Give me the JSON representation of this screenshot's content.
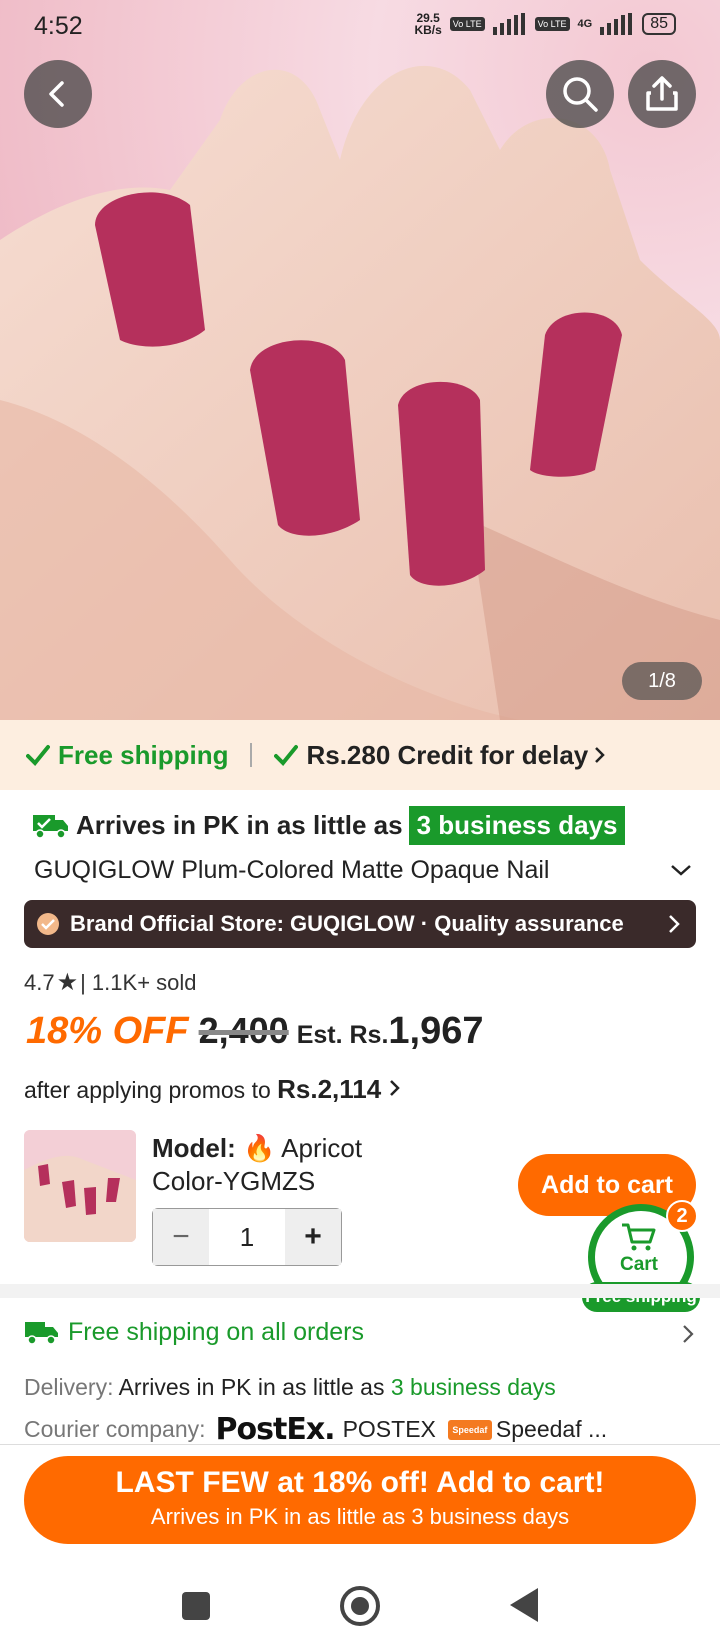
{
  "status_bar": {
    "time": "4:52",
    "net_speed_value": "29.5",
    "net_speed_unit": "KB/s",
    "lte1": "Vo LTE",
    "lte2": "Vo LTE",
    "network": "4G",
    "battery": "85"
  },
  "hero": {
    "image_counter": "1/8",
    "nail_color": "#b5305c"
  },
  "shipping_strip": {
    "free_shipping": "Free shipping",
    "credit": "Rs.280 Credit for delay"
  },
  "arrival": {
    "text": "Arrives in PK in as little as",
    "badge": "3 business days"
  },
  "product": {
    "title": "GUQIGLOW Plum-Colored Matte Opaque Nail",
    "store": "Brand Official Store: GUQIGLOW · Quality assurance",
    "rating": "4.7",
    "sold": "| 1.1K+ sold",
    "discount": "18% OFF",
    "original_price": "2,400",
    "est_label": "Est. Rs.",
    "final_price": "1,967",
    "promo_text": "after applying promos to",
    "promo_price": "Rs.2,114"
  },
  "model": {
    "label": "Model:",
    "value_line1": "Apricot",
    "value_line2": "Color-YGMZS",
    "quantity": "1",
    "minus": "−",
    "plus": "+"
  },
  "buttons": {
    "add_to_cart": "Add to cart",
    "cart_label": "Cart",
    "cart_count": "2",
    "cart_free_shipping": "Free shipping"
  },
  "delivery_info": {
    "free_all": "Free shipping on all orders",
    "delivery_label": "Delivery:",
    "delivery_text": "Arrives in PK in as little as",
    "delivery_days": "3 business days",
    "courier_label": "Courier company:",
    "courier_logo": "PostEx.",
    "courier1": "POSTEX",
    "courier2_logo": "Speedaf",
    "courier2": "Speedaf ..."
  },
  "cta": {
    "line1": "LAST FEW at 18% off! Add to cart!",
    "line2": "Arrives in PK in as little as 3 business days"
  },
  "colors": {
    "accent_orange": "#ff6a00",
    "green": "#1a9a2b",
    "store_bg": "#3a2a2a"
  }
}
